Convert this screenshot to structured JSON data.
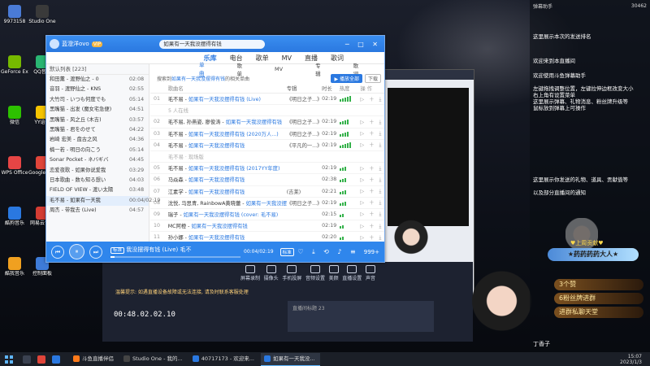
{
  "desktop_icons": [
    {
      "label": "9973158",
      "color": "#4a7bd6"
    },
    {
      "label": "GeForce Experience",
      "color": "#76b900"
    },
    {
      "label": "微信",
      "color": "#2dc100"
    },
    {
      "label": "WPS Office",
      "color": "#e64545"
    },
    {
      "label": "酷狗音乐",
      "color": "#2a78e0"
    },
    {
      "label": "酷我音乐",
      "color": "#f0a020"
    },
    {
      "label": "Studio One",
      "color": "#3a3a3a"
    },
    {
      "label": "QQ音乐",
      "color": "#2ab673"
    },
    {
      "label": "YY语音",
      "color": "#f5c400"
    },
    {
      "label": "Google Chrome",
      "color": "#e0453a"
    },
    {
      "label": "网易云音乐",
      "color": "#d43c33"
    },
    {
      "label": "控制面板",
      "color": "#3e7bd8"
    }
  ],
  "overlay": {
    "top_left": "弹幕助手",
    "top_right": "30462",
    "lines": [
      "这里展示本次的发送排名",
      "欢迎来到本直播间",
      "欢迎使用斗鱼弹幕助手",
      "左键拖拽调整位置，左键拉伸边框改变大小",
      "右上角有设置菜单",
      "这里展示弹幕、礼物消息、粉丝牌升级等",
      "鼠标放到弹幕上可操作",
      "这里展示你发送的礼物、道具、贡献值等",
      "以及部分直播间的通知"
    ],
    "star_badge": "★药药药药大人★",
    "week_title": "♥上周贡献♥",
    "tags": [
      "3个赞",
      "6粉丝牌进群",
      "进群私聊天堂"
    ],
    "bottom_name": "丁香子"
  },
  "player": {
    "user_name": "蓝澄洋ovo",
    "vip_label": "VIP",
    "level": "LV",
    "search_text": "如果有一天我没摆得有钱",
    "nav": [
      "乐库",
      "电台",
      "歌单",
      "MV",
      "直播",
      "歌词"
    ],
    "nav_active": 0,
    "left_header": "默认列表 [223]",
    "left_songs": [
      {
        "name": "和田薫 - 渡野仙之 - 0",
        "time": "02:08"
      },
      {
        "name": "音羽 - 渡野仙之 - KNS",
        "time": "02:55"
      },
      {
        "name": "大竹司 - いつも何度でも",
        "time": "05:14"
      },
      {
        "name": "黑嘴猫 - 出发 (魔女宅急便)",
        "time": "04:51"
      },
      {
        "name": "黑嘴猫 - 风之丘 (木吉)",
        "time": "03:57"
      },
      {
        "name": "黑嘴猫 - 君をのせて",
        "time": "04:22"
      },
      {
        "name": "岩崎 宏美 - 盘古之风",
        "time": "04:36"
      },
      {
        "name": "楠一若 - 明日の向こう",
        "time": "05:14"
      },
      {
        "name": "Sonar Pocket - ネバギバ",
        "time": "04:45"
      },
      {
        "name": "恋爱夜歌 - 如果你说爱我",
        "time": "03:29"
      },
      {
        "name": "日本歌曲 - 数も知る想い",
        "time": "04:03"
      },
      {
        "name": "FIELD OF VIEW - 渡い太陽",
        "time": "03:48"
      },
      {
        "name": "毛不易 - 如果有一天我",
        "time": "00:04/02:19"
      },
      {
        "name": "周杰 - 带我去 (Live)",
        "time": "04:57"
      }
    ],
    "left_selected": 12,
    "tabs": [
      "单曲",
      "歌单",
      "MV",
      "专辑",
      "歌词"
    ],
    "tab_active": 0,
    "search_prefix": "搜索到",
    "search_query": "如果有一天我没摆得有钱",
    "search_suffix": "的相关单曲",
    "btn_play_all": "▶ 播放全部",
    "btn_download": "下载",
    "headers": [
      "歌曲名",
      "专辑",
      "时长",
      "热度",
      "操作"
    ],
    "rows": [
      {
        "idx": "01",
        "artist": "毛不易 - ",
        "title": "如果有一天我没摆得有钱 (Live)",
        "album": "《明日之子...》",
        "dur": "02:19",
        "heat": 5
      },
      {
        "idx": "",
        "artist": "",
        "title": "5 人在线",
        "album": "",
        "dur": "",
        "heat": 0,
        "sub": true
      },
      {
        "idx": "02",
        "artist": "毛不易, 孙燕姿, 廖俊涛 - ",
        "title": "如果有一天我没摆得有钱",
        "album": "《明日之子...》",
        "dur": "02:19",
        "heat": 4
      },
      {
        "idx": "03",
        "artist": "毛不易 - ",
        "title": "如果有一天我没摆得有钱 (2020万人...)",
        "album": "《明日之子...》",
        "dur": "02:19",
        "heat": 4
      },
      {
        "idx": "04",
        "artist": "毛不易 - ",
        "title": "如果有一天我没摆得有钱",
        "album": "《平凡的一...》",
        "dur": "02:19",
        "heat": 5
      },
      {
        "idx": "",
        "artist": "",
        "title": "毛不易 · 现场版",
        "album": "",
        "dur": "",
        "heat": 0,
        "sub": true
      },
      {
        "idx": "05",
        "artist": "毛不易 - ",
        "title": "如果有一天我没摆得有钱 (2017YY年度)",
        "album": "",
        "dur": "02:19",
        "heat": 3
      },
      {
        "idx": "06",
        "artist": "马焱森 - ",
        "title": "如果有一天我没摆得有钱",
        "album": "",
        "dur": "02:38",
        "heat": 3
      },
      {
        "idx": "07",
        "artist": "江素学 - ",
        "title": "如果有一天我没摆得有钱",
        "album": "(吉莱)",
        "dur": "02:21",
        "heat": 3
      },
      {
        "idx": "08",
        "artist": "沈悦, 马思青, RainbowA黄晓蕾 - ",
        "title": "如果有一天我没摆得有钱",
        "album": "《明日之子...》",
        "dur": "02:19",
        "heat": 3
      },
      {
        "idx": "09",
        "artist": "瑞子 - ",
        "title": "如果有一天我没摆得有钱 (cover: 毛不易)",
        "album": "",
        "dur": "02:15",
        "heat": 2
      },
      {
        "idx": "10",
        "artist": "MC阿橙 - ",
        "title": "如果有一天我没摆得有钱",
        "album": "",
        "dur": "02:19",
        "heat": 2
      },
      {
        "idx": "11",
        "artist": "孙小娜 - ",
        "title": "如果有一天我没摆得有钱",
        "album": "",
        "dur": "02:20",
        "heat": 2
      }
    ],
    "bar": {
      "tag": "标准",
      "now_playing": "我没摆得有钱 (Live)",
      "artist": "毛不",
      "time": "00:04/02:19",
      "progress": 0.03,
      "quality": "标准",
      "count": "999+"
    }
  },
  "stream_tool": {
    "tools": [
      "屏幕录制",
      "摄像头",
      "手机投屏",
      "音频设置",
      "美颜",
      "直播设置",
      "声音"
    ],
    "notice": "温馨提示: 如遇直播设备故障或无法连接, 请及时联系客服处理",
    "timer": "00:48.02.02.10",
    "bottom_info": "直播间标题  23"
  },
  "taskbar": {
    "tasks": [
      {
        "label": "斗鱼直播伴侣",
        "color": "#ff7a1a",
        "active": false
      },
      {
        "label": "Studio One - 我的...",
        "color": "#444",
        "active": false
      },
      {
        "label": "40717173 - 欢迎来...",
        "color": "#2a78e0",
        "active": false
      },
      {
        "label": "如果有一天我没...",
        "color": "#2a78e0",
        "active": true
      }
    ],
    "time": "15:07",
    "date": "2023/1/3"
  }
}
